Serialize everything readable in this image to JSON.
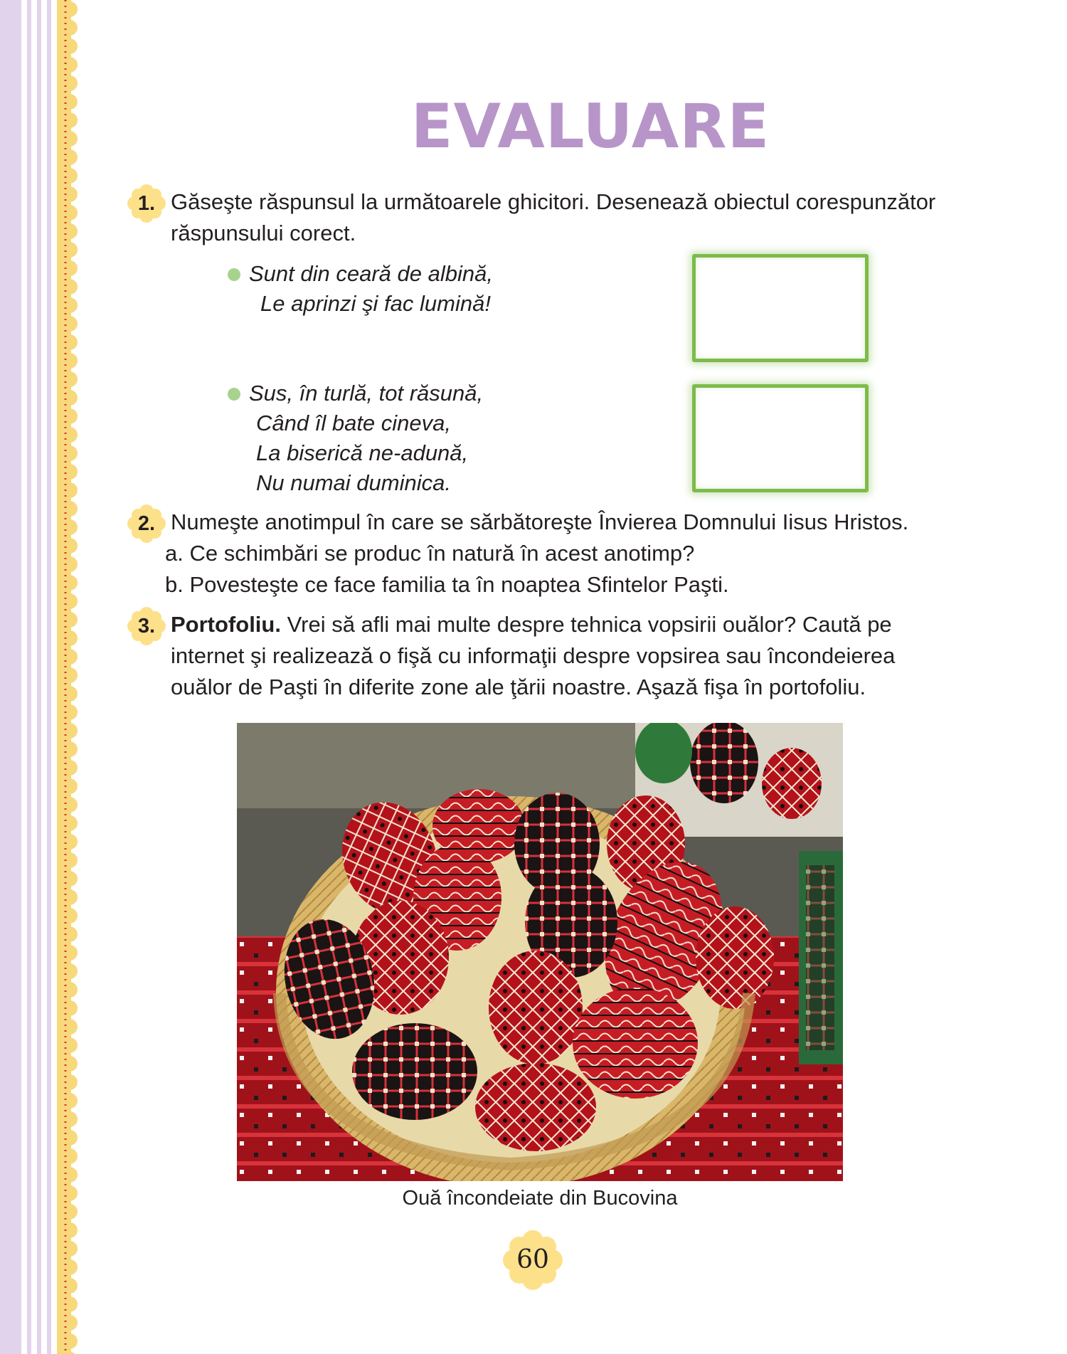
{
  "title": "EVALUARE",
  "colors": {
    "title": "#b795c9",
    "border_lilac": "#e2d3ec",
    "border_yellow": "#f7d97b",
    "dotted_red": "#e0362c",
    "answer_box_green": "#7dbb4a",
    "bullet_green": "#a8d38e",
    "badge_yellow": "#fde08a"
  },
  "exercises": [
    {
      "number": "1.",
      "text_line1": "Găseşte răspunsul la următoarele ghicitori. Desenează obiectul corespunzător",
      "text_line2": "răspunsului corect.",
      "riddles": [
        {
          "lines": [
            "Sunt din ceară de albină,",
            "Le aprinzi şi fac lumină!"
          ]
        },
        {
          "lines": [
            "Sus, în turlă, tot răsună,",
            "Când îl bate cineva,",
            "La biserică ne-adună,",
            "Nu numai duminica."
          ]
        }
      ]
    },
    {
      "number": "2.",
      "text": "Numeşte anotimpul în care se sărbătoreşte Învierea Domnului Iisus Hristos.",
      "sub_a": "a. Ce schimbări se produc în natură în acest anotimp?",
      "sub_b": "b. Povesteşte ce face familia ta în noaptea Sfintelor Paşti."
    },
    {
      "number": "3.",
      "bold_lead": "Portofoliu.",
      "text_line1": "Vrei să afli mai multe despre tehnica vopsirii ouălor? Caută pe",
      "text_line2": "internet şi realizează o fişă cu informaţii despre vopsirea sau încondeierea",
      "text_line3": "ouălor de Paşti în diferite zone ale ţării noastre. Aşază fişa în portofoliu."
    }
  ],
  "photo": {
    "icon": "easter-eggs-basket-photo",
    "caption": "Ouă încondeiate din Bucovina"
  },
  "page_number": "60"
}
